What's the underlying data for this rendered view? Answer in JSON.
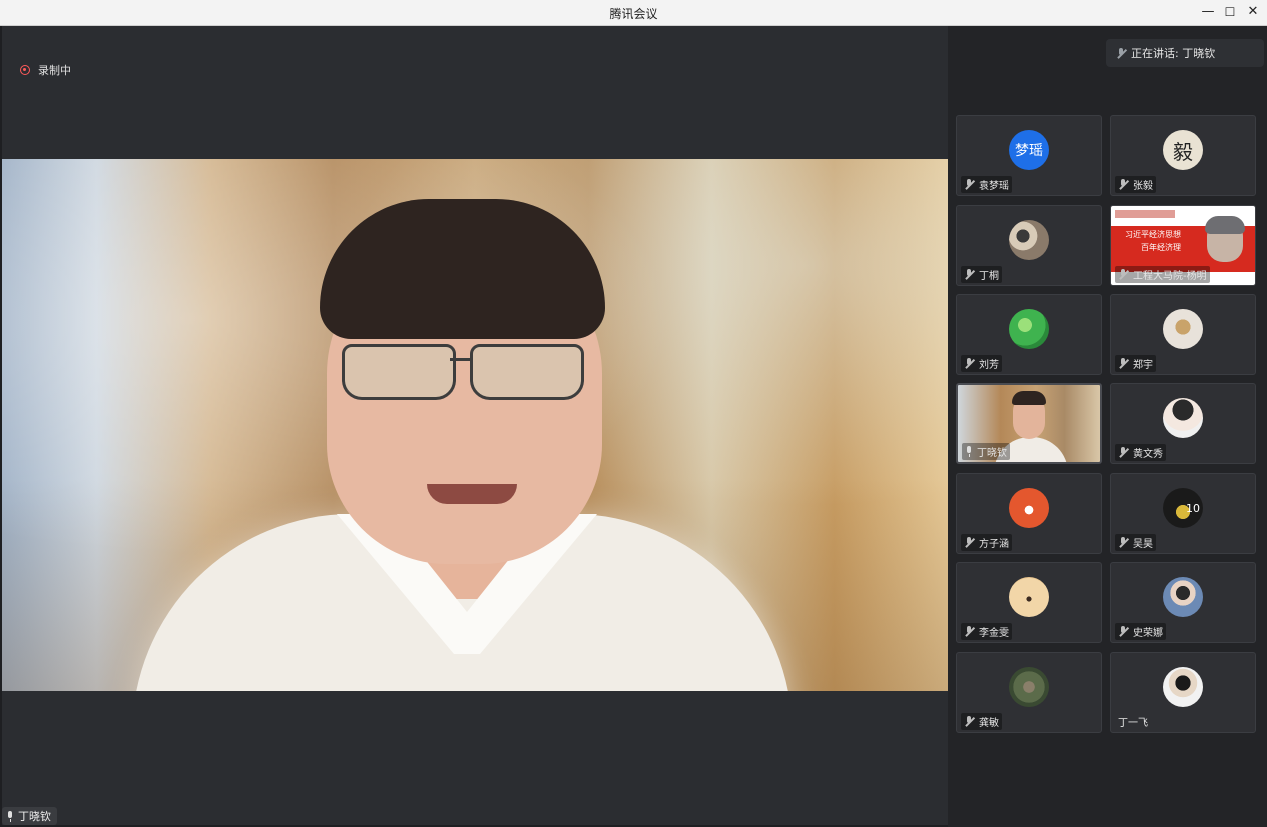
{
  "window": {
    "title": "腾讯会议",
    "controls": [
      "—",
      "☐",
      "✕"
    ]
  },
  "recording": {
    "label": "录制中"
  },
  "speaker_tag": {
    "name": "丁晓钦"
  },
  "speaking_now": {
    "label": "正在讲话: 丁晓钦"
  },
  "participants": [
    {
      "name": "袁梦瑶",
      "avatar_text": "梦瑶",
      "avatar_color": "#1e6fe8"
    },
    {
      "name": "张毅",
      "avatar_text": "毅",
      "avatar_color": "#e9e2d3"
    },
    {
      "name": "丁桐",
      "avatar_text": "",
      "avatar_color": "#8a7a6a"
    },
    {
      "name": "工程大马院-杨明",
      "slide_line1": "习近平经济思想",
      "slide_line2": "百年经济理",
      "avatar_color": "#d62a1f"
    },
    {
      "name": "刘芳",
      "avatar_text": "",
      "avatar_color": "#3fb34f"
    },
    {
      "name": "郑宇",
      "avatar_text": "",
      "avatar_color": "#e8e2da"
    },
    {
      "name": "丁晓钦",
      "avatar_text": "",
      "avatar_color": "#c7a274"
    },
    {
      "name": "黄文秀",
      "avatar_text": "",
      "avatar_color": "#f0f0f0"
    },
    {
      "name": "方子涵",
      "avatar_text": "",
      "avatar_color": "#e4572e"
    },
    {
      "name": "吴昊",
      "avatar_text": "10",
      "avatar_color": "#1a1a1a"
    },
    {
      "name": "李金雯",
      "avatar_text": "",
      "avatar_color": "#f2d6a8"
    },
    {
      "name": "史荣娜",
      "avatar_text": "",
      "avatar_color": "#6c8ab5"
    },
    {
      "name": "龚敏",
      "avatar_text": "",
      "avatar_color": "#5b6b4a"
    },
    {
      "name": "丁一飞",
      "avatar_text": "",
      "avatar_color": "#f2f2f2"
    }
  ]
}
